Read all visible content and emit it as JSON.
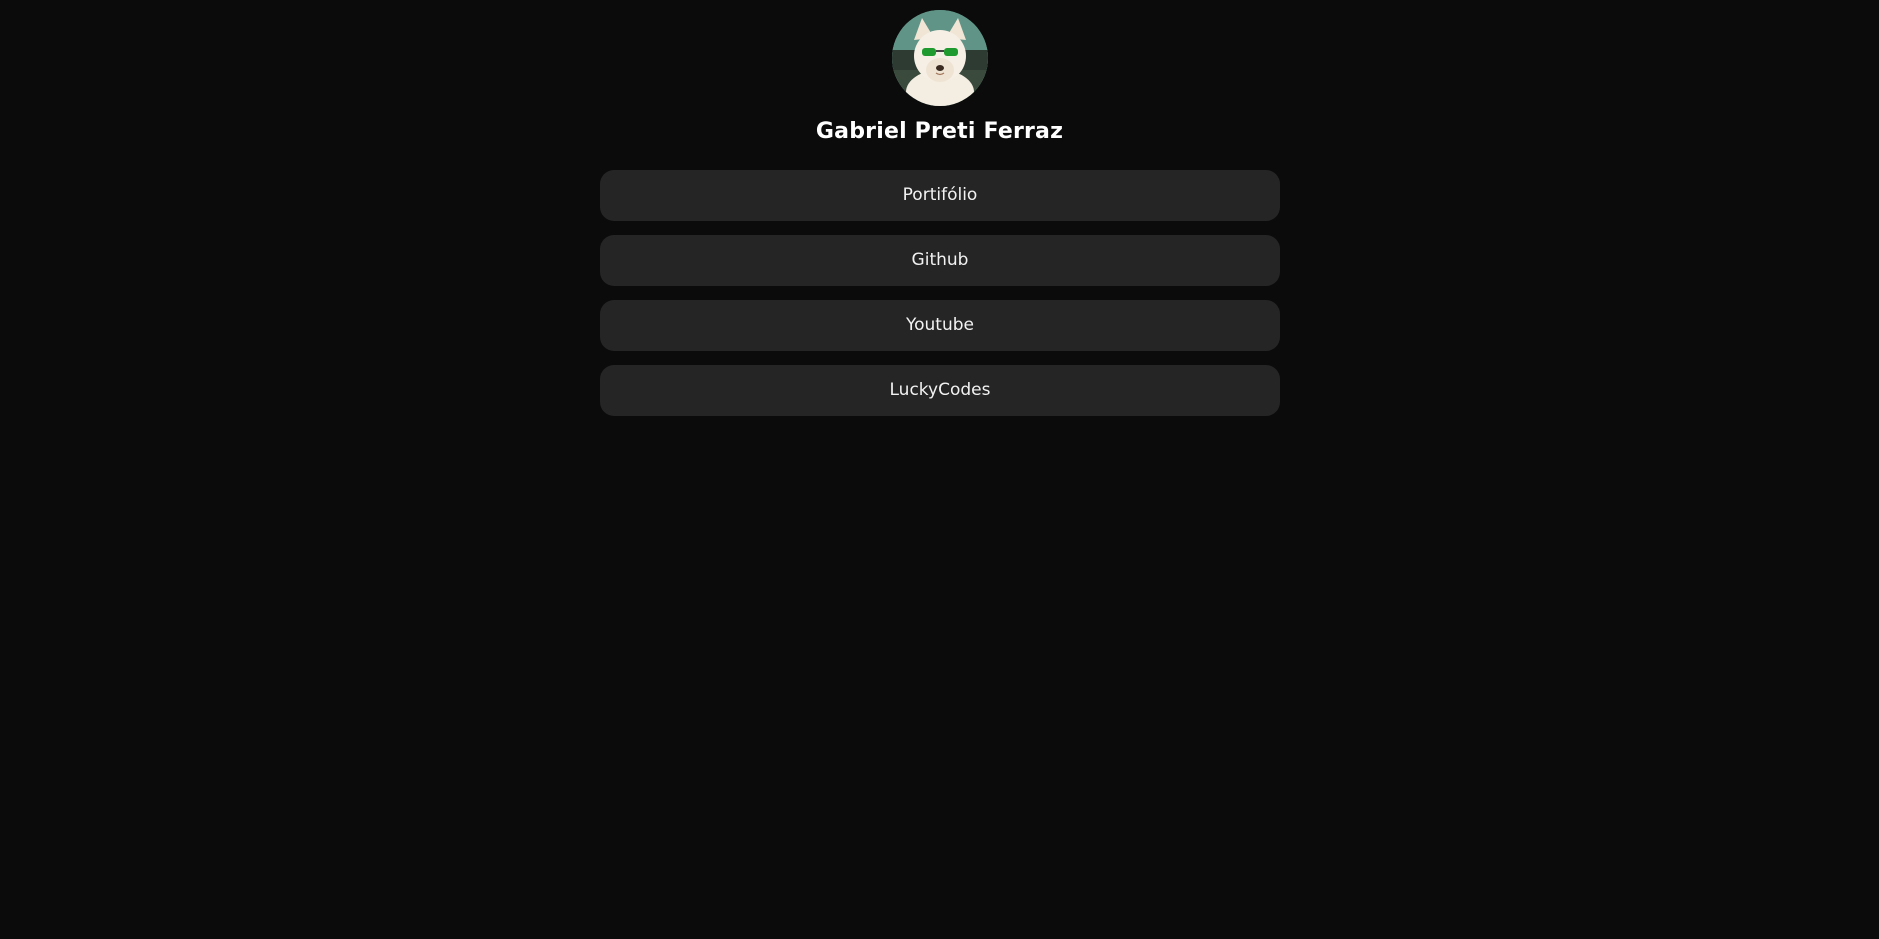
{
  "profile": {
    "name": "Gabriel Preti Ferraz",
    "avatar_icon": "dog-with-sunglasses-avatar"
  },
  "links": [
    {
      "label": "Portifólio"
    },
    {
      "label": "Github"
    },
    {
      "label": "Youtube"
    },
    {
      "label": "LuckyCodes"
    }
  ],
  "colors": {
    "background": "#0b0b0b",
    "button": "#252525",
    "text": "#ffffff"
  }
}
